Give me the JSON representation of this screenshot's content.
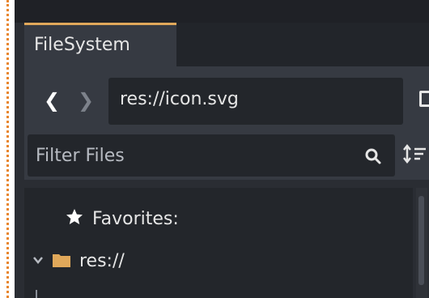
{
  "dock": {
    "tab_label": "FileSystem"
  },
  "navigation": {
    "back_icon": "chevron-left-icon",
    "forward_icon": "chevron-right-icon",
    "path_value": "res://icon.svg",
    "view_toggle_icon": "split-view-icon"
  },
  "filter": {
    "placeholder": "Filter Files",
    "search_icon": "search-icon",
    "sort_icon": "sort-icon"
  },
  "tree": {
    "favorites_label": "Favorites:",
    "favorites_icon": "star-icon",
    "root_label": "res://",
    "root_icon": "folder-icon",
    "root_expanded": true
  },
  "colors": {
    "tab_accent": "#e0a85a",
    "folder": "#e0a85a",
    "panel_bg": "#363a42",
    "field_bg": "#23262b"
  }
}
